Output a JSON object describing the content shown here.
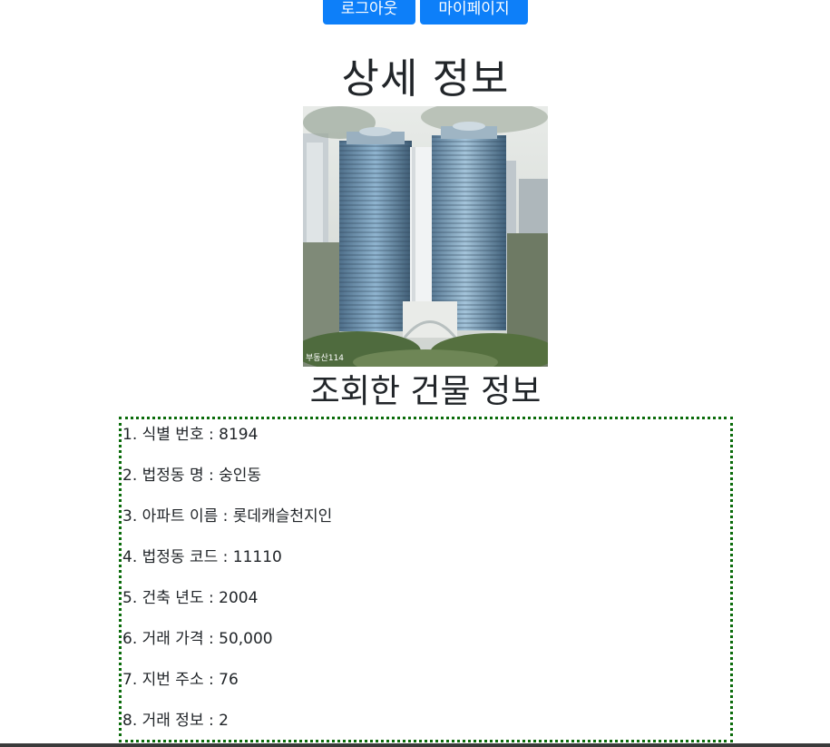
{
  "header": {
    "logout_label": "로그아웃",
    "mypage_label": "마이페이지"
  },
  "main": {
    "title": "상세 정보",
    "subtitle": "조회한 건물 정보",
    "image_watermark": "부동산114",
    "items": [
      "1. 식별 번호 : 8194",
      "2. 법정동 명 : 숭인동",
      "3. 아파트 이름 : 롯데캐슬천지인",
      "4. 법정동 코드 : 11110",
      "5. 건축 년도 : 2004",
      "6. 거래 가격 : 50,000",
      "7. 지번 주소 : 76",
      "8. 거래 정보 : 2"
    ]
  },
  "colors": {
    "button_bg": "#0d7ff9",
    "box_border": "#0a6b0a",
    "text": "#212529"
  }
}
